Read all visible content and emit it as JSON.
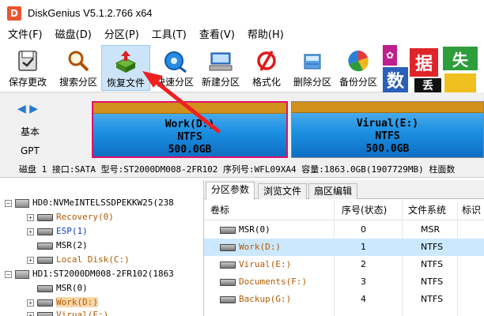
{
  "window": {
    "title": "DiskGenius V5.1.2.766 x64",
    "logo_glyph": "D"
  },
  "menu": [
    "文件(F)",
    "磁盘(D)",
    "分区(P)",
    "工具(T)",
    "查看(V)",
    "帮助(H)"
  ],
  "toolbar": {
    "items": [
      {
        "label": "保存更改",
        "icon": "save-icon"
      },
      {
        "label": "搜索分区",
        "icon": "search-icon"
      },
      {
        "label": "恢复文件",
        "icon": "recover-icon"
      },
      {
        "label": "快速分区",
        "icon": "quick-partition-icon"
      },
      {
        "label": "新建分区",
        "icon": "new-partition-icon"
      },
      {
        "label": "格式化",
        "icon": "format-icon"
      },
      {
        "label": "删除分区",
        "icon": "delete-partition-icon"
      },
      {
        "label": "备份分区",
        "icon": "backup-partition-icon"
      }
    ],
    "promo_chars": [
      "数",
      "据",
      "丢",
      "失"
    ]
  },
  "diskmap": {
    "nav": "◀ ▶",
    "label_basic": "基本",
    "label_gpt": "GPT",
    "partitions": [
      {
        "name": "Work(D:)",
        "fs": "NTFS",
        "size": "500.0GB"
      },
      {
        "name": "Virual(E:)",
        "fs": "NTFS",
        "size": "500.0GB"
      }
    ]
  },
  "diskinfo": "磁盘 1 接口:SATA  型号:ST2000DM008-2FR102  序列号:WFL09XA4  容量:1863.0GB(1907729MB)  柱面数",
  "tree": {
    "nodes": [
      {
        "text": "HD0:NVMeINTELSSDPEKKW25(238",
        "level": 0,
        "type": "disk",
        "color": "black"
      },
      {
        "text": "Recovery(0)",
        "level": 1,
        "type": "part",
        "color": "brown"
      },
      {
        "text": "ESP(1)",
        "level": 1,
        "type": "part",
        "color": "blue"
      },
      {
        "text": "MSR(2)",
        "level": 1,
        "type": "part",
        "color": "black"
      },
      {
        "text": "Local Disk(C:)",
        "level": 1,
        "type": "part",
        "color": "brown"
      },
      {
        "text": "HD1:ST2000DM008-2FR102(1863",
        "level": 0,
        "type": "disk",
        "color": "black"
      },
      {
        "text": "MSR(0)",
        "level": 1,
        "type": "part",
        "color": "black"
      },
      {
        "text": "Work(D:)",
        "level": 1,
        "type": "part",
        "color": "brown"
      },
      {
        "text": "Virual(E:)",
        "level": 1,
        "type": "part",
        "color": "brown"
      }
    ]
  },
  "tabs": [
    "分区参数",
    "浏览文件",
    "扇区编辑"
  ],
  "table": {
    "columns": [
      "卷标",
      "序号(状态)",
      "文件系统",
      "标识"
    ],
    "rows": [
      {
        "name": "MSR(0)",
        "index": "0",
        "fs": "MSR",
        "color": "black"
      },
      {
        "name": "Work(D:)",
        "index": "1",
        "fs": "NTFS",
        "color": "brown"
      },
      {
        "name": "Virual(E:)",
        "index": "2",
        "fs": "NTFS",
        "color": "brown"
      },
      {
        "name": "Documents(F:)",
        "index": "3",
        "fs": "NTFS",
        "color": "brown"
      },
      {
        "name": "Backup(G:)",
        "index": "4",
        "fs": "NTFS",
        "color": "brown"
      }
    ]
  }
}
